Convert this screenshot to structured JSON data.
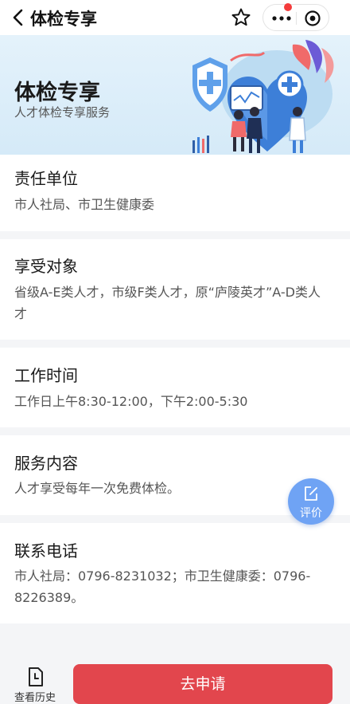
{
  "nav": {
    "title": "体检专享"
  },
  "banner": {
    "title": "体检专享",
    "subtitle": "人才体检专享服务"
  },
  "cards": [
    {
      "title": "责任单位",
      "body": "市人社局、市卫生健康委"
    },
    {
      "title": "享受对象",
      "body": "省级A-E类人才，市级F类人才，原“庐陵英才”A-D类人才"
    },
    {
      "title": "工作时间",
      "body": "工作日上午8:30-12:00，下午2:00-5:30"
    },
    {
      "title": "服务内容",
      "body": "人才享受每年一次免费体检。"
    },
    {
      "title": "联系电话",
      "body": "市人社局：0796-8231032；市卫生健康委：0796-8226389。"
    }
  ],
  "fab": {
    "label": "评价"
  },
  "bottom": {
    "history_label": "查看历史",
    "apply_label": "去申请"
  },
  "colors": {
    "primary_button": "#e2464d",
    "fab": "#6fa3f4",
    "banner_bg": "#d5eaf8",
    "notification_dot": "#f43b3b"
  }
}
